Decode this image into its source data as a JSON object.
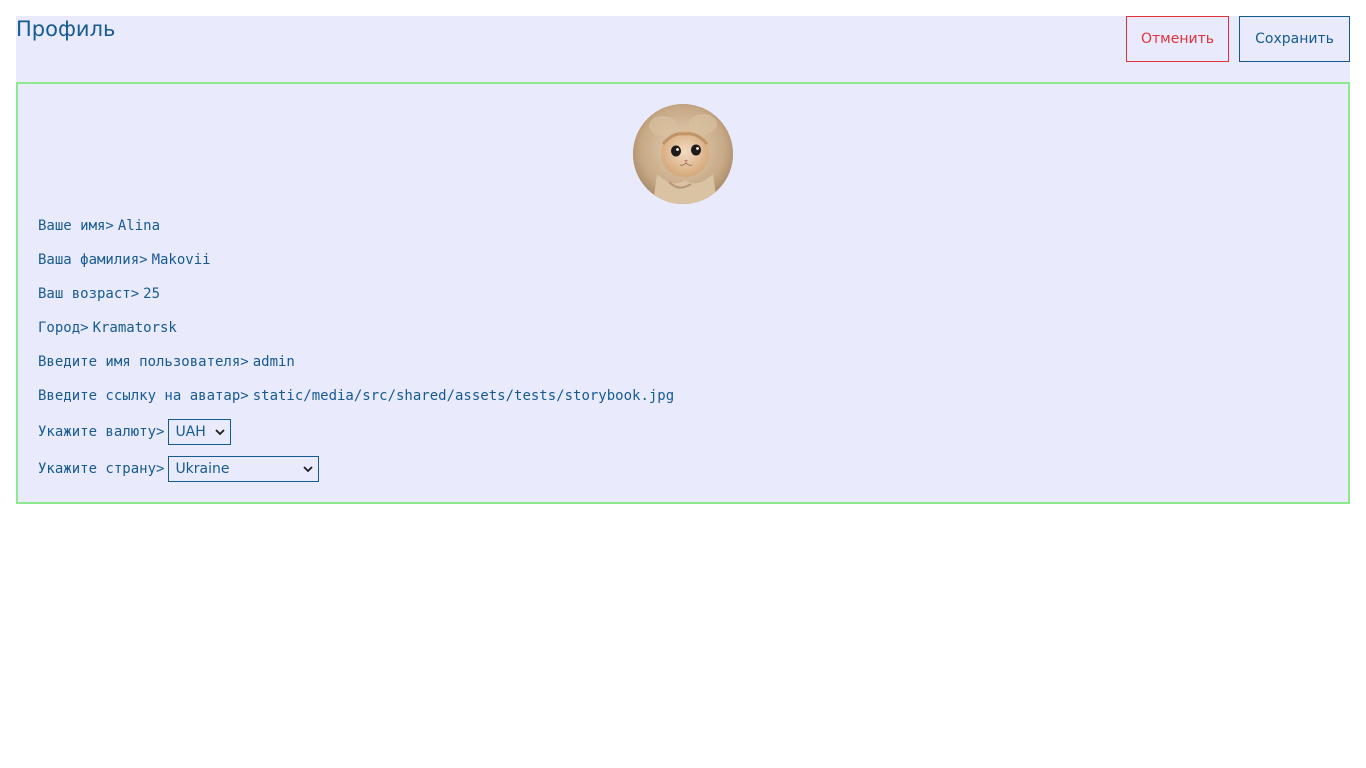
{
  "header": {
    "title": "Профиль",
    "cancel_label": "Отменить",
    "save_label": "Сохранить"
  },
  "colors": {
    "accent": "#175a92",
    "danger": "#e0323a",
    "card_border": "#8ee88e",
    "background": "#e9ebfd"
  },
  "profile": {
    "avatar_icon": "avatar-cat-image",
    "fields": [
      {
        "label": "Ваше имя>",
        "value": "Alina"
      },
      {
        "label": "Ваша фамилия>",
        "value": "Makovii"
      },
      {
        "label": "Ваш возраст>",
        "value": "25"
      },
      {
        "label": "Город>",
        "value": "Kramatorsk"
      },
      {
        "label": "Введите имя пользователя>",
        "value": "admin"
      },
      {
        "label": "Введите ссылку на аватар>",
        "value": "static/media/src/shared/assets/tests/storybook.jpg"
      }
    ],
    "currency": {
      "label": "Укажите валюту>",
      "selected": "UAH"
    },
    "country": {
      "label": "Укажите страну>",
      "selected": "Ukraine"
    }
  }
}
